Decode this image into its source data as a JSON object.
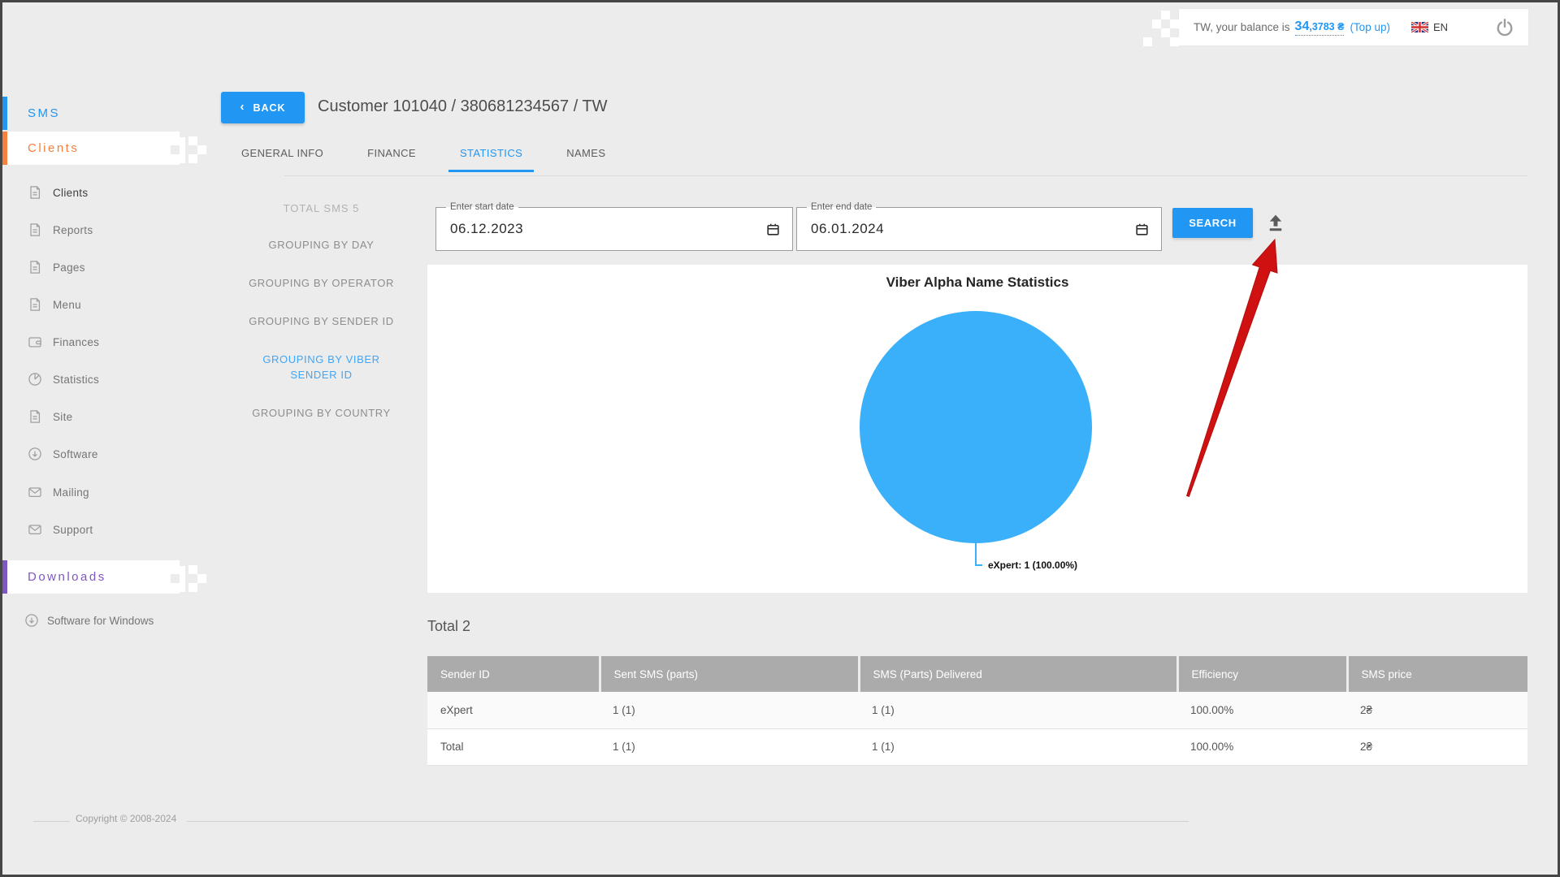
{
  "topbar": {
    "balance_prefix": "TW, your balance is",
    "balance_int": "34",
    "balance_frac": ",3783 ₴",
    "topup_label": "(Top up)",
    "language": "EN"
  },
  "sidebar": {
    "sms_section": "SMS",
    "clients_section": "Clients",
    "downloads_section": "Downloads",
    "items": [
      {
        "label": "Clients",
        "icon": "document-icon"
      },
      {
        "label": "Reports",
        "icon": "document-icon"
      },
      {
        "label": "Pages",
        "icon": "document-icon"
      },
      {
        "label": "Menu",
        "icon": "document-icon"
      },
      {
        "label": "Finances",
        "icon": "wallet-icon"
      },
      {
        "label": "Statistics",
        "icon": "pie-icon"
      },
      {
        "label": "Site",
        "icon": "document-icon"
      },
      {
        "label": "Software",
        "icon": "download-icon"
      },
      {
        "label": "Mailing",
        "icon": "envelope-icon"
      },
      {
        "label": "Support",
        "icon": "envelope-icon"
      }
    ],
    "downloads_item": {
      "label": "Software for Windows",
      "icon": "download-icon"
    }
  },
  "header": {
    "back_label": "BACK",
    "back_chevron": "‹",
    "title": "Customer 101040 / 380681234567 / TW"
  },
  "tabs": [
    {
      "label": "GENERAL INFO"
    },
    {
      "label": "FINANCE"
    },
    {
      "label": "STATISTICS"
    },
    {
      "label": "NAMES"
    }
  ],
  "subnav": {
    "total_label": "TOTAL SMS 5",
    "items": [
      "GROUPING BY DAY",
      "GROUPING BY OPERATOR",
      "GROUPING BY SENDER ID",
      "GROUPING BY VIBER SENDER ID",
      "GROUPING BY COUNTRY"
    ],
    "active_item": "GROUPING BY VIBER SENDER ID"
  },
  "filters": {
    "start_date": {
      "label": "Enter start date",
      "value": "06.12.2023"
    },
    "end_date": {
      "label": "Enter end date",
      "value": "06.01.2024"
    },
    "search_label": "SEARCH"
  },
  "chart_data": {
    "type": "pie",
    "title": "Viber Alpha Name Statistics",
    "labels": [
      "eXpert"
    ],
    "values": [
      1
    ],
    "percentages": [
      100.0
    ],
    "slice_colors": [
      "#3aaffa"
    ],
    "annotation": "eXpert: 1 (100.00%)",
    "legend_position": "none"
  },
  "table": {
    "total_label": "Total 2",
    "columns": [
      "Sender ID",
      "Sent SMS (parts)",
      "SMS (Parts) Delivered",
      "Efficiency",
      "SMS price"
    ],
    "rows": [
      {
        "cells": [
          "eXpert",
          "1 (1)",
          "1 (1)",
          "100.00%",
          "2₴"
        ]
      },
      {
        "cells": [
          "Total",
          "1 (1)",
          "1 (1)",
          "100.00%",
          "2₴"
        ]
      }
    ]
  },
  "footer": {
    "copyright": "Copyright © 2008-2024"
  },
  "colors": {
    "accent_blue": "#2196f3",
    "pie_blue": "#3aaffa",
    "orange": "#f5813d",
    "purple": "#7e57c2",
    "table_header": "#ababab",
    "background": "#ececec",
    "arrow_red": "#d01111"
  }
}
